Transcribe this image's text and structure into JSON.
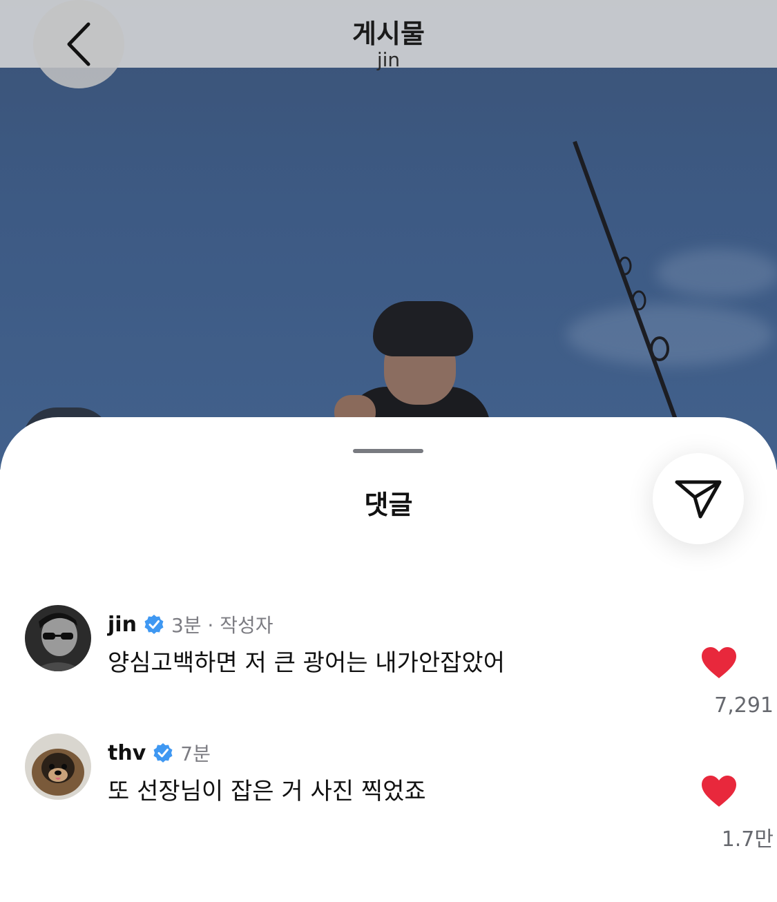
{
  "header": {
    "title": "게시물",
    "subtitle": "jin"
  },
  "sheet": {
    "title": "댓글"
  },
  "comments": [
    {
      "username": "jin",
      "verified": true,
      "time": "3분",
      "tag": "작성자",
      "meta": "3분 · 작성자",
      "text": "양심고백하면 저 큰 광어는 내가안잡았어",
      "likes": "7,291",
      "liked": true
    },
    {
      "username": "thv",
      "verified": true,
      "time": "7분",
      "meta": "7분",
      "text": "또 선장님이 잡은 거 사진 찍었죠",
      "likes": "1.7만",
      "liked": true
    }
  ],
  "colors": {
    "like": "#e8283c",
    "verified": "#3f98f2",
    "sky": "#3d5a84"
  },
  "icons": {
    "back": "chevron-left-icon",
    "share": "send-icon",
    "verified": "verified-badge-icon",
    "like": "heart-icon"
  }
}
